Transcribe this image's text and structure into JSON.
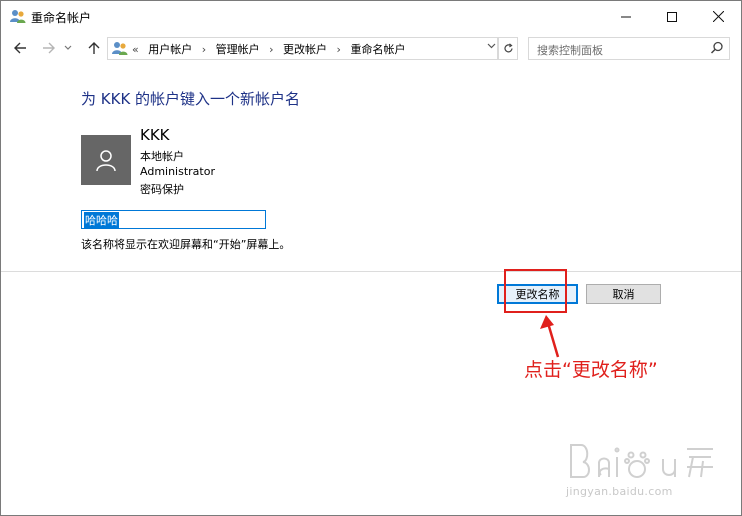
{
  "window": {
    "title": "重命名帐户",
    "title_icon": "user-accounts-icon",
    "controls": {
      "minimize": "minimize-icon",
      "maximize": "maximize-icon",
      "close": "close-icon"
    }
  },
  "nav": {
    "back": "back-arrow-icon",
    "forward": "forward-arrow-icon",
    "recent": "chevron-down-icon",
    "up": "up-arrow-icon",
    "overflow": "«",
    "breadcrumbs": [
      "用户帐户",
      "管理帐户",
      "更改帐户",
      "重命名帐户"
    ],
    "search_placeholder": "搜索控制面板"
  },
  "content": {
    "heading": "为 KKK 的帐户键入一个新帐户名",
    "account": {
      "name": "KKK",
      "type": "本地帐户",
      "group": "Administrator",
      "password": "密码保护"
    },
    "input_value": "哈哈哈",
    "hint": "该名称将显示在欢迎屏幕和“开始”屏幕上。"
  },
  "buttons": {
    "rename": "更改名称",
    "cancel": "取消"
  },
  "annotation": {
    "text": "点击“更改名称”",
    "color": "#e0201c"
  },
  "watermark": {
    "url": "jingyan.baidu.com"
  },
  "colors": {
    "accent": "#0078d7",
    "heading": "#1e3287"
  }
}
